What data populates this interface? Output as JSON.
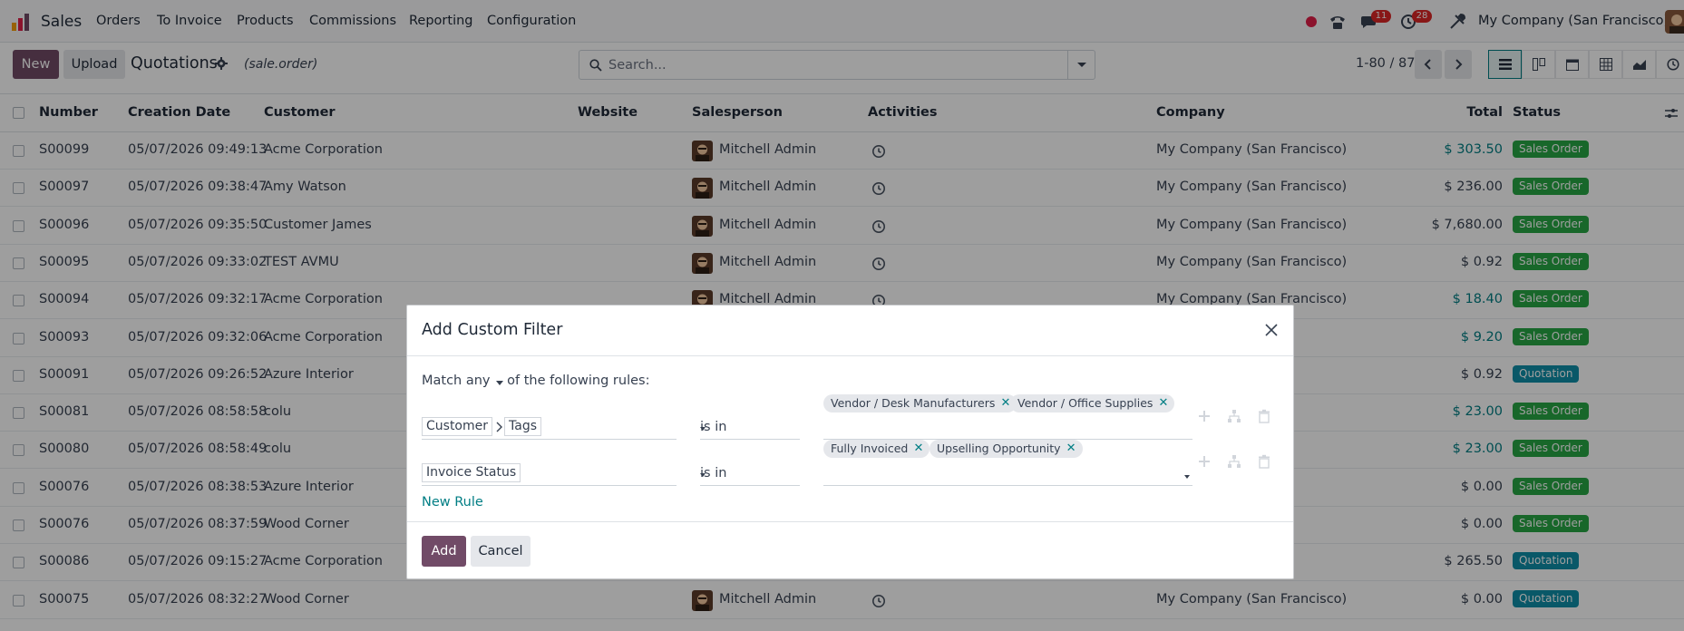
{
  "app": {
    "name": "Sales"
  },
  "menu": [
    {
      "label": "Orders"
    },
    {
      "label": "To Invoice"
    },
    {
      "label": "Products"
    },
    {
      "label": "Commissions"
    },
    {
      "label": "Reporting"
    },
    {
      "label": "Configuration"
    }
  ],
  "systray": {
    "messages_count": "11",
    "activities_count": "28",
    "company": "My Company (San Francisco)"
  },
  "control_panel": {
    "new_label": "New",
    "upload_label": "Upload",
    "title": "Quotations",
    "model": "(sale.order)",
    "search_placeholder": "Search...",
    "pager": "1-80 / 87"
  },
  "list": {
    "columns": {
      "number": "Number",
      "creation_date": "Creation Date",
      "customer": "Customer",
      "website": "Website",
      "salesperson": "Salesperson",
      "activities": "Activities",
      "company": "Company",
      "total": "Total",
      "status": "Status"
    },
    "rows": [
      {
        "number": "S00099",
        "date": "05/07/2026 09:49:13",
        "customer": "Acme Corporation",
        "salesperson": "Mitchell Admin",
        "company": "My Company (San Francisco)",
        "total": "$ 303.50",
        "total_link": true,
        "status": "Sales Order"
      },
      {
        "number": "S00097",
        "date": "05/07/2026 09:38:47",
        "customer": "Amy Watson",
        "salesperson": "Mitchell Admin",
        "company": "My Company (San Francisco)",
        "total": "$ 236.00",
        "total_link": false,
        "status": "Sales Order"
      },
      {
        "number": "S00096",
        "date": "05/07/2026 09:35:50",
        "customer": "Customer James",
        "salesperson": "Mitchell Admin",
        "company": "My Company (San Francisco)",
        "total": "$ 7,680.00",
        "total_link": false,
        "status": "Sales Order"
      },
      {
        "number": "S00095",
        "date": "05/07/2026 09:33:02",
        "customer": "TEST AVMU",
        "salesperson": "Mitchell Admin",
        "company": "My Company (San Francisco)",
        "total": "$ 0.92",
        "total_link": false,
        "status": "Sales Order"
      },
      {
        "number": "S00094",
        "date": "05/07/2026 09:32:17",
        "customer": "Acme Corporation",
        "salesperson": "Mitchell Admin",
        "company": "My Company (San Francisco)",
        "total": "$ 18.40",
        "total_link": true,
        "status": "Sales Order"
      },
      {
        "number": "S00093",
        "date": "05/07/2026 09:32:06",
        "customer": "Acme Corporation",
        "salesperson": "",
        "company": "",
        "total": "$ 9.20",
        "total_link": true,
        "status": "Sales Order"
      },
      {
        "number": "S00091",
        "date": "05/07/2026 09:26:52",
        "customer": "Azure Interior",
        "salesperson": "",
        "company": "",
        "total": "$ 0.92",
        "total_link": false,
        "status": "Quotation"
      },
      {
        "number": "S00081",
        "date": "05/07/2026 08:58:58",
        "customer": "colu",
        "salesperson": "",
        "company": "",
        "total": "$ 23.00",
        "total_link": true,
        "status": "Sales Order"
      },
      {
        "number": "S00080",
        "date": "05/07/2026 08:58:49",
        "customer": "colu",
        "salesperson": "",
        "company": "",
        "total": "$ 23.00",
        "total_link": true,
        "status": "Sales Order"
      },
      {
        "number": "S00076",
        "date": "05/07/2026 08:38:53",
        "customer": "Azure Interior",
        "salesperson": "",
        "company": "",
        "total": "$ 0.00",
        "total_link": false,
        "status": "Sales Order"
      },
      {
        "number": "S00076",
        "date": "05/07/2026 08:37:59",
        "customer": "Wood Corner",
        "salesperson": "",
        "company": "",
        "total": "$ 0.00",
        "total_link": false,
        "status": "Sales Order"
      },
      {
        "number": "S00086",
        "date": "05/07/2026 09:15:27",
        "customer": "Acme Corporation",
        "salesperson": "",
        "company": "",
        "total": "$ 265.50",
        "total_link": false,
        "status": "Quotation"
      },
      {
        "number": "S00075",
        "date": "05/07/2026 08:32:27",
        "customer": "Wood Corner",
        "salesperson": "Mitchell Admin",
        "company": "My Company (San Francisco)",
        "total": "$ 0.00",
        "total_link": false,
        "status": "Quotation"
      }
    ]
  },
  "dialog": {
    "title": "Add Custom Filter",
    "match_prefix": "Match",
    "match_value": "any",
    "match_suffix": "of the following rules:",
    "rules": [
      {
        "path": [
          "Customer",
          "Tags"
        ],
        "operator": "is in",
        "values": [
          "Vendor / Desk Manufacturers",
          "Vendor / Office Supplies"
        ]
      },
      {
        "path": [
          "Invoice Status"
        ],
        "operator": "is in",
        "values": [
          "Fully Invoiced",
          "Upselling Opportunity"
        ]
      }
    ],
    "new_rule_label": "New Rule",
    "add_label": "Add",
    "cancel_label": "Cancel"
  },
  "colors": {
    "brand": "#714b67",
    "accent": "#017e84",
    "sales_order": "#28a745",
    "quotation": "#0f8fa8"
  }
}
